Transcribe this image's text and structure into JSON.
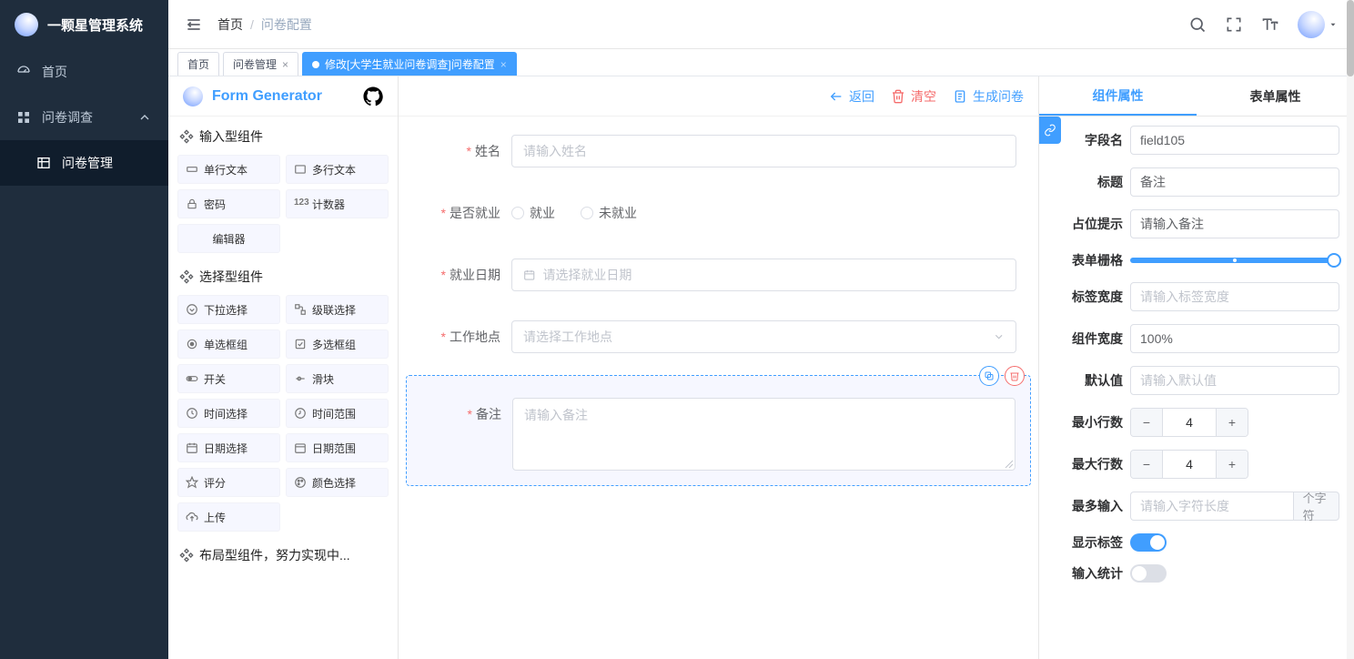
{
  "brand": {
    "title": "一颗星管理系统"
  },
  "nav": {
    "home": "首页",
    "survey": "问卷调查",
    "surveyMgmt": "问卷管理"
  },
  "crumb": {
    "home": "首页",
    "current": "问卷配置"
  },
  "tabs": [
    {
      "label": "首页"
    },
    {
      "label": "问卷管理"
    },
    {
      "label": "修改[大学生就业问卷调查]问卷配置",
      "active": true
    }
  ],
  "generator": {
    "title": "Form Generator"
  },
  "palette": {
    "groupInput": "输入型组件",
    "groupSelect": "选择型组件",
    "groupLayout": "布局型组件，努力实现中...",
    "items": {
      "singleLine": "单行文本",
      "multiLine": "多行文本",
      "password": "密码",
      "counter": "计数器",
      "editor": "编辑器",
      "select": "下拉选择",
      "cascader": "级联选择",
      "radioGroup": "单选框组",
      "checkGroup": "多选框组",
      "switch": "开关",
      "slider": "滑块",
      "time": "时间选择",
      "timeRange": "时间范围",
      "date": "日期选择",
      "dateRange": "日期范围",
      "rate": "评分",
      "color": "颜色选择",
      "upload": "上传"
    }
  },
  "canvasHdr": {
    "back": "返回",
    "clear": "清空",
    "generate": "生成问卷"
  },
  "form": {
    "name": {
      "label": "姓名",
      "placeholder": "请输入姓名"
    },
    "employed": {
      "label": "是否就业",
      "opt1": "就业",
      "opt2": "未就业"
    },
    "empDate": {
      "label": "就业日期",
      "placeholder": "请选择就业日期"
    },
    "workPlace": {
      "label": "工作地点",
      "placeholder": "请选择工作地点"
    },
    "remark": {
      "label": "备注",
      "placeholder": "请输入备注"
    }
  },
  "propsTabs": {
    "component": "组件属性",
    "form": "表单属性"
  },
  "props": {
    "fieldName": {
      "label": "字段名",
      "value": "field105"
    },
    "title": {
      "label": "标题",
      "value": "备注"
    },
    "placeholder": {
      "label": "占位提示",
      "value": "请输入备注"
    },
    "grid": {
      "label": "表单栅格"
    },
    "labelWidth": {
      "label": "标签宽度",
      "placeholder": "请输入标签宽度"
    },
    "compWidth": {
      "label": "组件宽度",
      "value": "100%"
    },
    "default": {
      "label": "默认值",
      "placeholder": "请输入默认值"
    },
    "minRows": {
      "label": "最小行数",
      "value": "4"
    },
    "maxRows": {
      "label": "最大行数",
      "value": "4"
    },
    "maxInput": {
      "label": "最多输入",
      "placeholder": "请输入字符长度",
      "unit": "个字符"
    },
    "showLabel": {
      "label": "显示标签"
    },
    "inputStat": {
      "label": "输入统计"
    }
  }
}
